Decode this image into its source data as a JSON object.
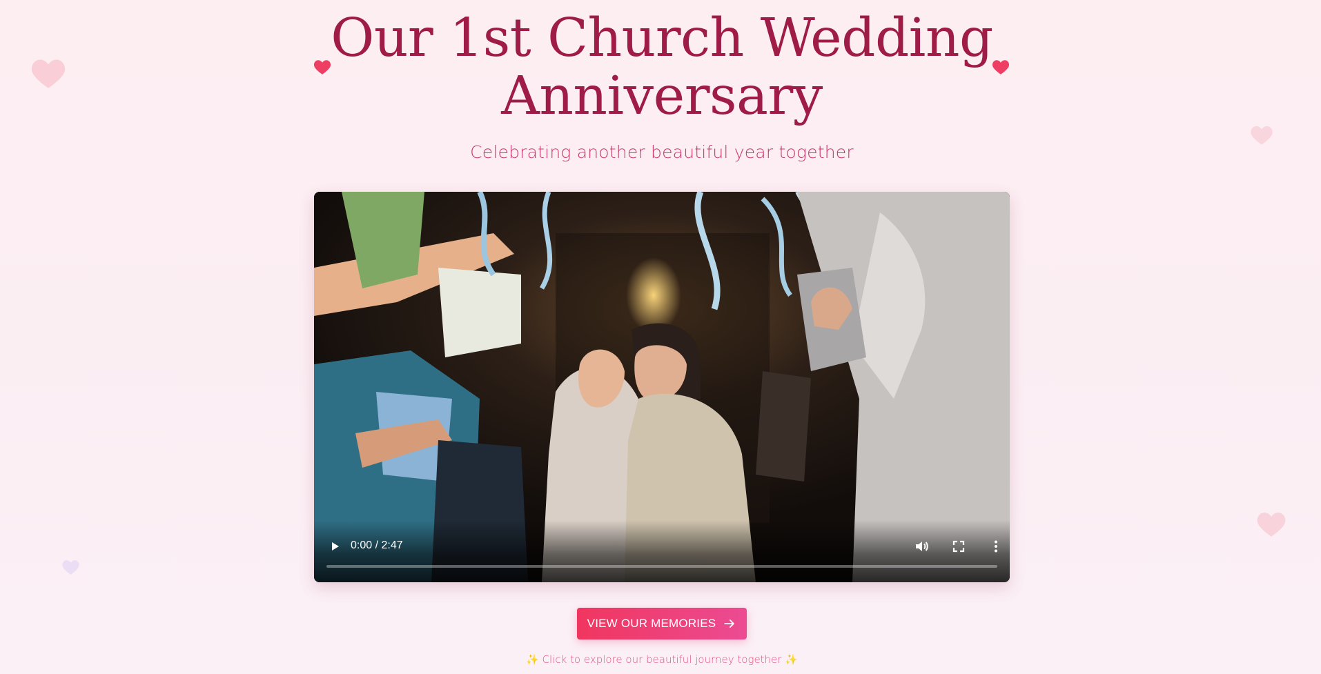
{
  "header": {
    "title": "Our 1st Church Wedding Anniversary",
    "subtitle": "Celebrating another beautiful year together"
  },
  "video": {
    "time_display": "0:00 / 2:47",
    "progress": 0.0,
    "controls": [
      "play-icon",
      "volume-icon",
      "fullscreen-icon",
      "more-options-icon"
    ]
  },
  "cta": {
    "label": "VIEW OUR MEMORIES",
    "icon": "arrow-right-icon"
  },
  "hint": {
    "leading_icon": "✨",
    "text": "Click to explore our beautiful journey together",
    "trailing_icon": "✨"
  },
  "colors": {
    "title": "#9e1c47",
    "subtitle": "#c8386a",
    "accent_heart": "#ef3e63",
    "button_start": "#f0365f",
    "button_end": "#ec4b93"
  }
}
